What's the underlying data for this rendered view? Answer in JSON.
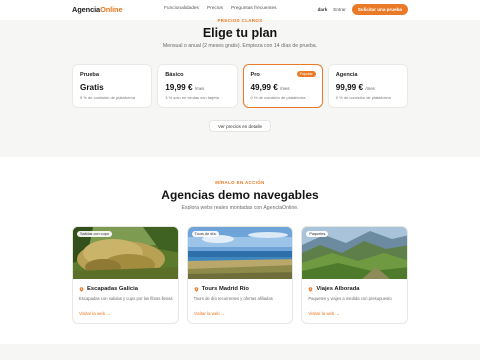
{
  "nav": {
    "logo_part1": "Agencia",
    "logo_part2": "Online",
    "links": [
      "Funcionalidades",
      "Precios",
      "Preguntas frecuentes"
    ],
    "dark_toggle": "dark",
    "login": "Entrar",
    "cta": "Solicitar una prueba"
  },
  "pricing": {
    "eyebrow": "PRECIOS CLAROS",
    "title": "Elige tu plan",
    "subtitle": "Mensual o anual (2 meses gratis). Empieza con 14 días de prueba.",
    "plans": [
      {
        "name": "Prueba",
        "price": "Gratis",
        "per": "",
        "note": "5 % de comisión de plataforma"
      },
      {
        "name": "Básico",
        "price": "19,99 €",
        "per": "/mes",
        "note": "3 % solo en ventas con tarjeta"
      },
      {
        "name": "Pro",
        "price": "49,99 €",
        "per": "/mes",
        "note": "0 % de comisión de plataforma",
        "badge": "Popular"
      },
      {
        "name": "Agencia",
        "price": "99,99 €",
        "per": "/mes",
        "note": "0 % de comisión de plataforma"
      }
    ],
    "details_button": "Ver precios en detalle"
  },
  "demos": {
    "eyebrow": "MÍRALO EN ACCIÓN",
    "title": "Agencias demo navegables",
    "subtitle": "Explora webs reales montadas con AgenciaOnline.",
    "agencies": [
      {
        "tag": "Salidas con cupo",
        "name": "Escapadas Galicia",
        "desc": "Escapadas con salidas y cupo por las fibras llenas",
        "link": "Visitar la web →",
        "image": "moss-covered-trees"
      },
      {
        "tag": "Tours de día",
        "name": "Tours Madrid Río",
        "desc": "Tours de día recurrentes y ofertas afiliadas",
        "link": "Visitar la web →",
        "image": "coastline-sea"
      },
      {
        "tag": "Paquetes",
        "name": "Viajes Alborada",
        "desc": "Paquetes y viajes a medida con presupuesto",
        "link": "Visitar la web →",
        "image": "green-mountains"
      }
    ]
  },
  "colors": {
    "accent": "#ea7a27",
    "bg": "#f6f6f4"
  }
}
